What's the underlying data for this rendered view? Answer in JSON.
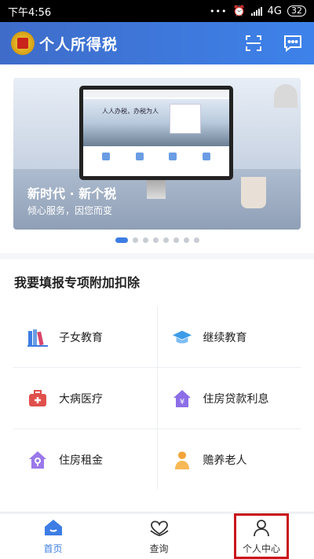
{
  "status_bar": {
    "time": "下午4:56",
    "dots": "•••",
    "network": "4G",
    "battery": "32"
  },
  "header": {
    "title": "个人所得税",
    "scan_icon": "scan-icon",
    "message_icon": "message-icon"
  },
  "banner": {
    "title": "新时代 · 新个税",
    "subtitle": "倾心服务，因您而变",
    "screen_motto": "人人办税，办税为人",
    "page_count": 8,
    "active_page": 0
  },
  "section": {
    "title": "我要填报专项附加扣除",
    "items": [
      {
        "label": "子女教育",
        "icon": "books-icon"
      },
      {
        "label": "继续教育",
        "icon": "graduation-cap-icon"
      },
      {
        "label": "大病医疗",
        "icon": "medical-kit-icon"
      },
      {
        "label": "住房贷款利息",
        "icon": "house-yuan-icon"
      },
      {
        "label": "住房租金",
        "icon": "house-key-icon"
      },
      {
        "label": "赡养老人",
        "icon": "elder-icon"
      }
    ]
  },
  "nav": [
    {
      "label": "首页",
      "icon": "home-icon",
      "active": true
    },
    {
      "label": "查询",
      "icon": "heart-hands-icon",
      "active": false
    },
    {
      "label": "个人中心",
      "icon": "person-icon",
      "active": false
    }
  ],
  "colors": {
    "brand_blue": "#3d7de4",
    "highlight_red": "#c9141c"
  }
}
